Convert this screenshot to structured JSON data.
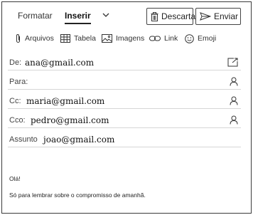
{
  "header": {
    "tabs": [
      {
        "label": "Formatar",
        "active": false
      },
      {
        "label": "Inserir",
        "active": true
      }
    ],
    "discard_label": "Descartar",
    "send_label": "Enviar"
  },
  "toolbar": {
    "items": [
      {
        "label": "Arquivos",
        "icon": "paperclip-icon"
      },
      {
        "label": "Tabela",
        "icon": "table-icon"
      },
      {
        "label": "Imagens",
        "icon": "image-icon"
      },
      {
        "label": "Link",
        "icon": "link-icon"
      },
      {
        "label": "Emoji",
        "icon": "emoji-icon"
      }
    ]
  },
  "fields": {
    "from": {
      "label": "De:",
      "value": "ana@gmail.com"
    },
    "to": {
      "label": "Para:",
      "value": ""
    },
    "cc": {
      "label": "Cc:",
      "value": "maria@gmail.com"
    },
    "bcc": {
      "label": "Cco:",
      "value": "pedro@gmail.com"
    },
    "subject": {
      "label": "Assunto",
      "value": "joao@gmail.com"
    }
  },
  "message": {
    "greeting": "Olá!",
    "line1": "Só para lembrar sobre o compromisso de amanhã."
  }
}
